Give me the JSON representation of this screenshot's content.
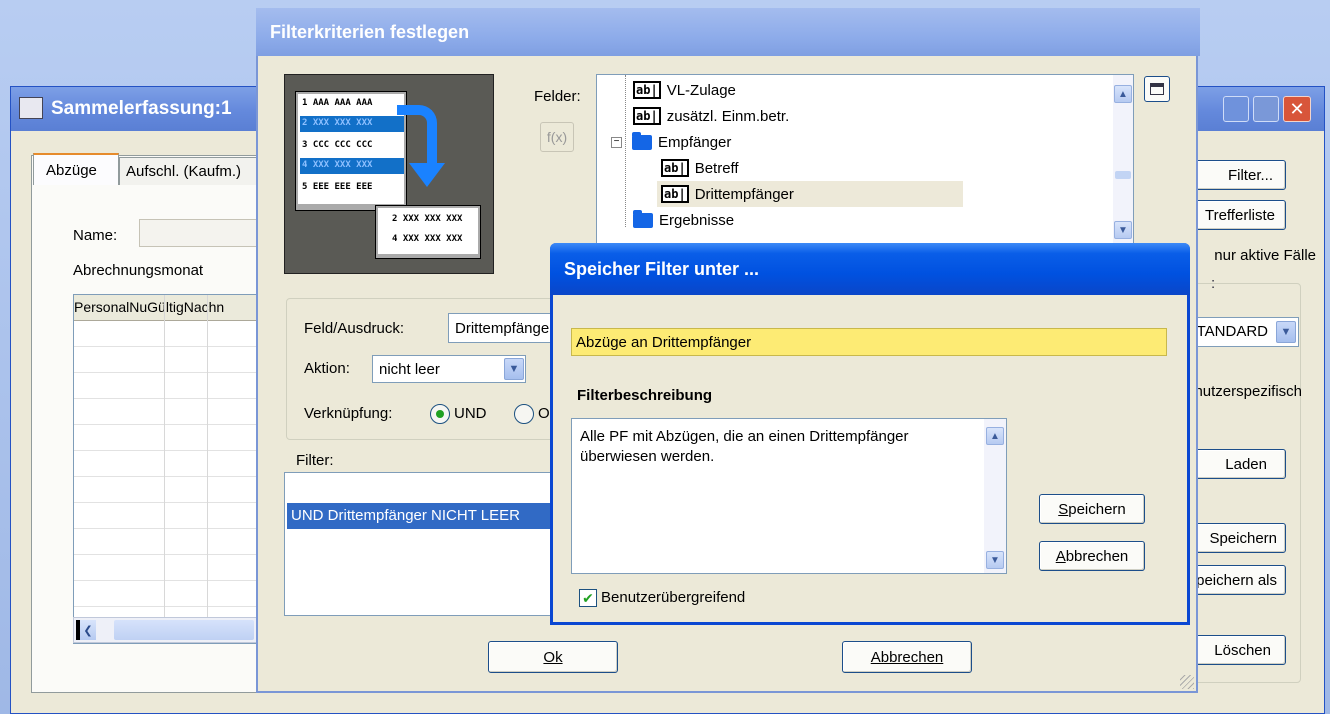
{
  "bg_window": {
    "title": "Sammelerfassung:1",
    "tabs": [
      "Abzüge",
      "Aufschl. (Kaufm.)"
    ],
    "name_label": "Name:",
    "month_label": "Abrechnungsmonat",
    "grid_header": "PersonalNuGültigNachn",
    "right_buttons": [
      "Filter...",
      "Trefferliste",
      "Laden",
      "Speichern",
      "Speichern als",
      "Löschen"
    ],
    "right_texts": [
      "nur aktive Fälle",
      "STANDARD",
      "Benutzerspezifisch"
    ]
  },
  "filter_dialog": {
    "title": "Filterkriterien festlegen",
    "felder_label": "Felder:",
    "fx_label": "f(x)",
    "tree": [
      {
        "label": "VL-Zulage",
        "icon": "abl-field-icon"
      },
      {
        "label": "zusätzl. Einm.betr.",
        "icon": "abl-field-icon"
      },
      {
        "label": "Empfänger",
        "icon": "folder-icon"
      },
      {
        "label": "Betreff",
        "icon": "abl-field-icon"
      },
      {
        "label": "Drittempfänger",
        "icon": "abl-field-icon"
      },
      {
        "label": "Ergebnisse",
        "icon": "folder-icon"
      }
    ],
    "feld_label": "Feld/Ausdruck:",
    "feld_value": "Drittempfänger",
    "aktion_label": "Aktion:",
    "aktion_value": "nicht leer",
    "verknuepfung_label": "Verknüpfung:",
    "und_label": "UND",
    "oder_label": "ODER",
    "filter_label": "Filter:",
    "filter_line": "UND Drittempfänger NICHT LEER",
    "ok_button": "Ok",
    "cancel_button": "Abbrechen",
    "illustration_rows": [
      "1 AAA AAA AAA",
      "2 XXX XXX XXX",
      "3 CCC CCC CCC",
      "4 XXX XXX XXX",
      "5 EEE EEE EEE"
    ],
    "illustration_result": [
      "2 XXX XXX XXX",
      "4 XXX XXX XXX"
    ]
  },
  "save_dialog": {
    "title": "Speicher Filter unter ...",
    "name_value": "Abzüge an Drittempfänger",
    "desc_label": "Filterbeschreibung",
    "desc_value": "Alle PF mit Abzügen, die an einen Drittempfänger überwiesen werden.",
    "save_button": "Speichern",
    "cancel_button": "Abbrechen",
    "checkbox_label": "Benutzerübergreifend",
    "checkbox_checked": true
  }
}
